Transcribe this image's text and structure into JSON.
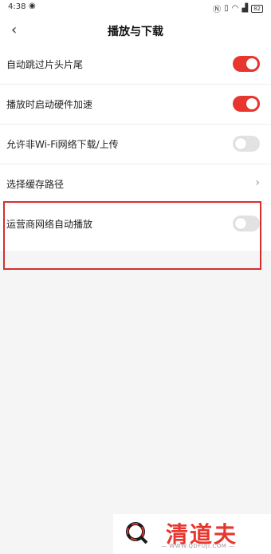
{
  "status_bar": {
    "time": "4:38",
    "battery": "82"
  },
  "header": {
    "title": "播放与下载"
  },
  "settings": [
    {
      "label": "自动跳过片头片尾",
      "control": "toggle",
      "on": true
    },
    {
      "label": "播放时启动硬件加速",
      "control": "toggle",
      "on": true
    },
    {
      "label": "允许非Wi-Fi网络下载/上传",
      "control": "toggle",
      "on": false
    },
    {
      "label": "选择缓存路径",
      "control": "chevron"
    },
    {
      "label": "运营商网络自动播放",
      "control": "toggle",
      "on": false
    }
  ],
  "watermark": {
    "brand": "清道夫",
    "url": "— WWW.QDFUJI.COM —"
  },
  "colors": {
    "accent": "#e8352e",
    "highlight_border": "#d32f2f",
    "toggle_off": "#e2e2e2"
  }
}
